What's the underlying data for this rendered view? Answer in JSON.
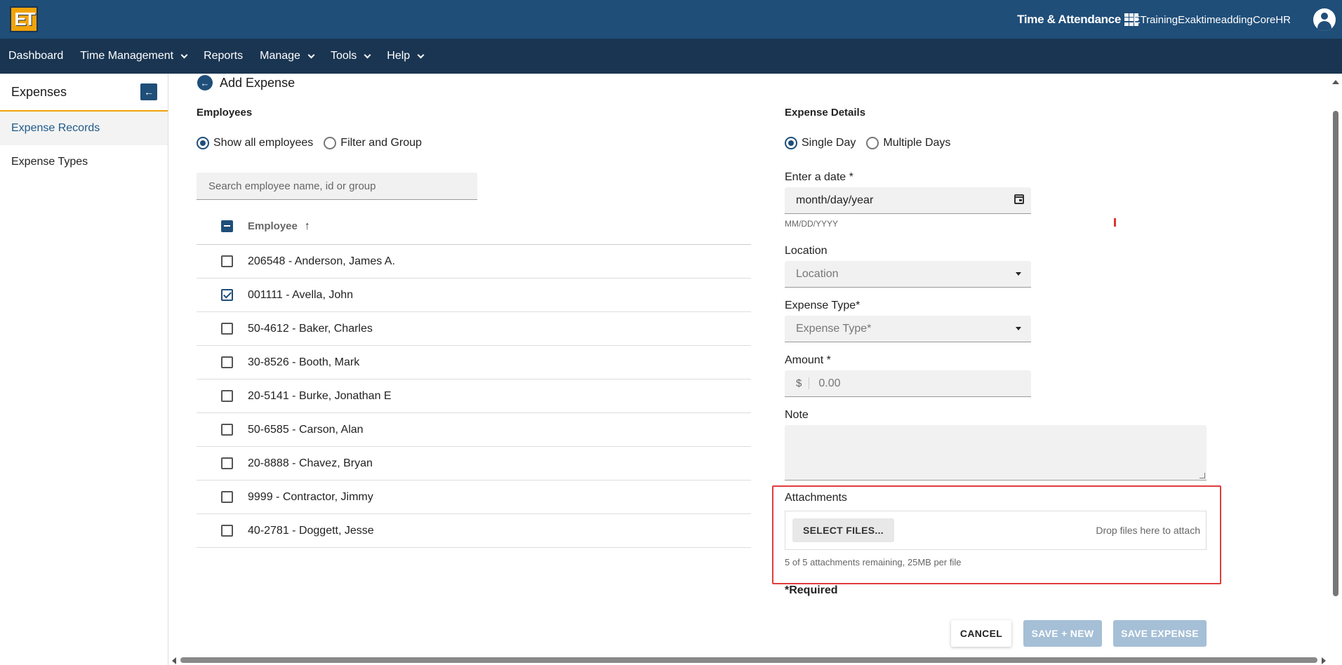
{
  "header": {
    "logo_text": "ET",
    "app_title": "Time & Attendance",
    "user_name": "ETrainingExaktimeaddingCoreHR",
    "brand_color": "#1f4e79"
  },
  "nav": {
    "items": [
      {
        "label": "Dashboard"
      },
      {
        "label": "Time Management"
      },
      {
        "label": "Reports"
      },
      {
        "label": "Manage"
      },
      {
        "label": "Tools"
      },
      {
        "label": "Help"
      }
    ]
  },
  "sidebar": {
    "title": "Expenses",
    "items": [
      {
        "label": "Expense Records",
        "active": true
      },
      {
        "label": "Expense Types",
        "active": false
      }
    ]
  },
  "page": {
    "title": "Add Expense"
  },
  "employees": {
    "section_label": "Employees",
    "radio_all": "Show all employees",
    "radio_filter": "Filter and Group",
    "selected_mode": "Show all employees",
    "search_placeholder": "Search employee name, id or group",
    "column_header": "Employee",
    "rows": [
      {
        "label": "206548 - Anderson, James A.",
        "checked": false
      },
      {
        "label": "001111 - Avella, John",
        "checked": true
      },
      {
        "label": "50-4612 - Baker, Charles",
        "checked": false
      },
      {
        "label": "30-8526 - Booth, Mark",
        "checked": false
      },
      {
        "label": "20-5141 - Burke, Jonathan E",
        "checked": false
      },
      {
        "label": "50-6585 - Carson, Alan",
        "checked": false
      },
      {
        "label": "20-8888 - Chavez, Bryan",
        "checked": false
      },
      {
        "label": "9999 - Contractor, Jimmy",
        "checked": false
      },
      {
        "label": "40-2781 - Doggett, Jesse",
        "checked": false
      }
    ]
  },
  "details": {
    "section_label": "Expense Details",
    "radio_single": "Single Day",
    "radio_multiple": "Multiple Days",
    "selected_mode": "Single Day",
    "date_label": "Enter a date *",
    "date_value": "month/day/year",
    "date_hint": "MM/DD/YYYY",
    "location_label": "Location",
    "location_placeholder": "Location",
    "type_label": "Expense Type*",
    "type_placeholder": "Expense Type*",
    "amount_label": "Amount *",
    "amount_prefix": "$",
    "amount_placeholder": "0.00",
    "note_label": "Note",
    "attachments_label": "Attachments",
    "select_files": "SELECT FILES...",
    "drop_text": "Drop files here to attach",
    "attachments_info": "5 of 5 attachments remaining, 25MB per file",
    "required_note": "*Required"
  },
  "actions": {
    "cancel": "CANCEL",
    "save_new": "SAVE + NEW",
    "save_expense": "SAVE EXPENSE"
  }
}
